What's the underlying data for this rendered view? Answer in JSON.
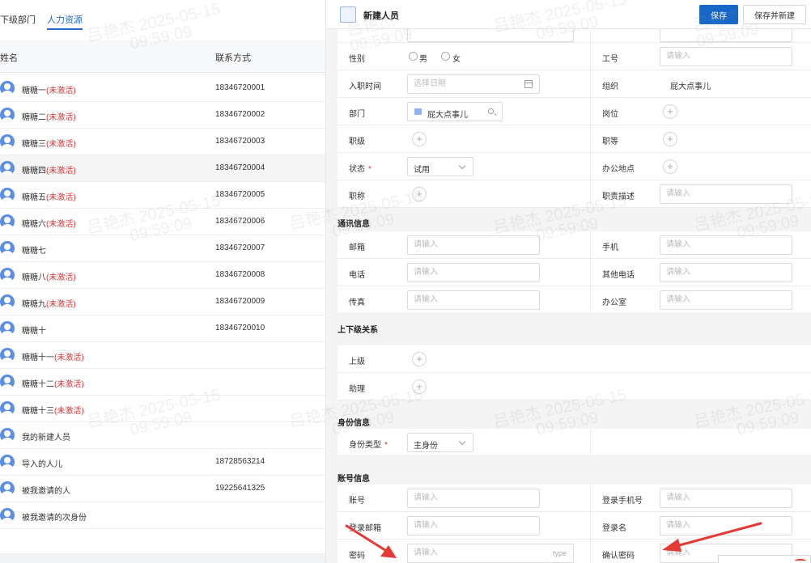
{
  "tabs": [
    "下级部门",
    "人力资源"
  ],
  "table": {
    "headers": {
      "name": "姓名",
      "contact": "联系方式"
    },
    "inactive_label": "(未激活)",
    "rows": [
      {
        "name": "糖糖一",
        "inactive": true,
        "phone": "18346720001"
      },
      {
        "name": "糖糖二",
        "inactive": true,
        "phone": "18346720002"
      },
      {
        "name": "糖糖三",
        "inactive": true,
        "phone": "18346720003"
      },
      {
        "name": "糖糖四",
        "inactive": true,
        "phone": "18346720004",
        "selected": true
      },
      {
        "name": "糖糖五",
        "inactive": true,
        "phone": "18346720005"
      },
      {
        "name": "糖糖六",
        "inactive": true,
        "phone": "18346720006"
      },
      {
        "name": "糖糖七",
        "inactive": false,
        "phone": "18346720007"
      },
      {
        "name": "糖糖八",
        "inactive": true,
        "phone": "18346720008"
      },
      {
        "name": "糖糖九",
        "inactive": true,
        "phone": "18346720009"
      },
      {
        "name": "糖糖十",
        "inactive": false,
        "phone": "18346720010"
      },
      {
        "name": "糖糖十一",
        "inactive": true,
        "phone": ""
      },
      {
        "name": "糖糖十二",
        "inactive": true,
        "phone": ""
      },
      {
        "name": "糖糖十三",
        "inactive": true,
        "phone": ""
      },
      {
        "name": "我的新建人员",
        "inactive": false,
        "phone": ""
      },
      {
        "name": "导入的人儿",
        "inactive": false,
        "phone": "18728563214"
      },
      {
        "name": "被我邀请的人",
        "inactive": false,
        "phone": "19225641325"
      },
      {
        "name": "被我邀请的次身份",
        "inactive": false,
        "phone": ""
      }
    ]
  },
  "dialog": {
    "title": "新建人员",
    "save_label": "保存",
    "save_new_label": "保存并新建",
    "placeholder_input": "请输入",
    "placeholder_date": "选择日期",
    "gender": {
      "label": "性别",
      "male": "男",
      "female": "女"
    },
    "employee_no": "工号",
    "entry_date": "入职时间",
    "org": {
      "label": "组织",
      "value": "屁大点事儿"
    },
    "dept": {
      "label": "部门",
      "value": "屁大点事儿"
    },
    "position": "岗位",
    "rank": "职级",
    "grade": "职等",
    "status": {
      "label": "状态",
      "value": "试用"
    },
    "office_location": "办公地点",
    "title_field": "职称",
    "job_desc": "职责描述",
    "sections": {
      "contact": "通讯信息",
      "hierarchy": "上下级关系",
      "identity": "身份信息",
      "account": "账号信息"
    },
    "email": "邮箱",
    "mobile": "手机",
    "phone": "电话",
    "other_phone": "其他电话",
    "fax": "传真",
    "office": "办公室",
    "superior": "上级",
    "assistant": "助理",
    "identity_type": {
      "label": "身份类型",
      "value": "主身份"
    },
    "account_no": "账号",
    "login_mobile": "登录手机号",
    "login_email": "登录邮箱",
    "login_name": "登录名",
    "password": "密码",
    "password_tip": "type",
    "confirm_password": "确认密码"
  },
  "watermark": {
    "name": "吕艳杰",
    "date": "2025-05-15",
    "time": "09:59:09"
  },
  "colors": {
    "primary": "#1667c8",
    "inactive": "#e03131",
    "arrow": "#e53935"
  }
}
